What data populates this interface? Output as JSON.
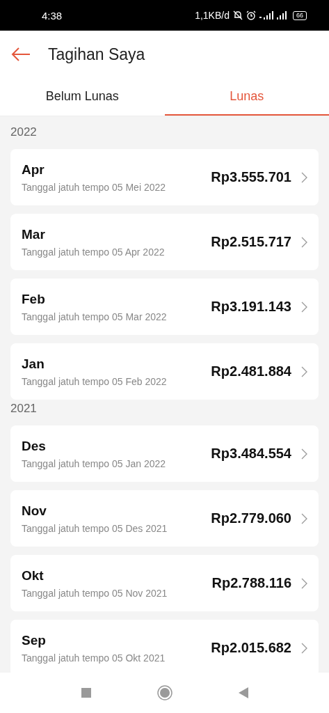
{
  "status_bar": {
    "time": "4:38",
    "speed": "1,1KB/d",
    "battery": "66"
  },
  "header": {
    "title": "Tagihan Saya"
  },
  "tabs": [
    {
      "label": "Belum Lunas",
      "selected": false
    },
    {
      "label": "Lunas",
      "selected": true
    }
  ],
  "groups": [
    {
      "year": "2022",
      "bills": [
        {
          "month": "Apr",
          "due": "Tanggal jatuh tempo 05 Mei 2022",
          "amount": "Rp3.555.701"
        },
        {
          "month": "Mar",
          "due": "Tanggal jatuh tempo 05 Apr 2022",
          "amount": "Rp2.515.717"
        },
        {
          "month": "Feb",
          "due": "Tanggal jatuh tempo 05 Mar 2022",
          "amount": "Rp3.191.143"
        },
        {
          "month": "Jan",
          "due": "Tanggal jatuh tempo 05 Feb 2022",
          "amount": "Rp2.481.884"
        }
      ]
    },
    {
      "year": "2021",
      "bills": [
        {
          "month": "Des",
          "due": "Tanggal jatuh tempo 05 Jan 2022",
          "amount": "Rp3.484.554"
        },
        {
          "month": "Nov",
          "due": "Tanggal jatuh tempo 05 Des 2021",
          "amount": "Rp2.779.060"
        },
        {
          "month": "Okt",
          "due": "Tanggal jatuh tempo 05 Nov 2021",
          "amount": "Rp2.788.116"
        },
        {
          "month": "Sep",
          "due": "Tanggal jatuh tempo 05 Okt 2021",
          "amount": "Rp2.015.682"
        }
      ]
    }
  ]
}
